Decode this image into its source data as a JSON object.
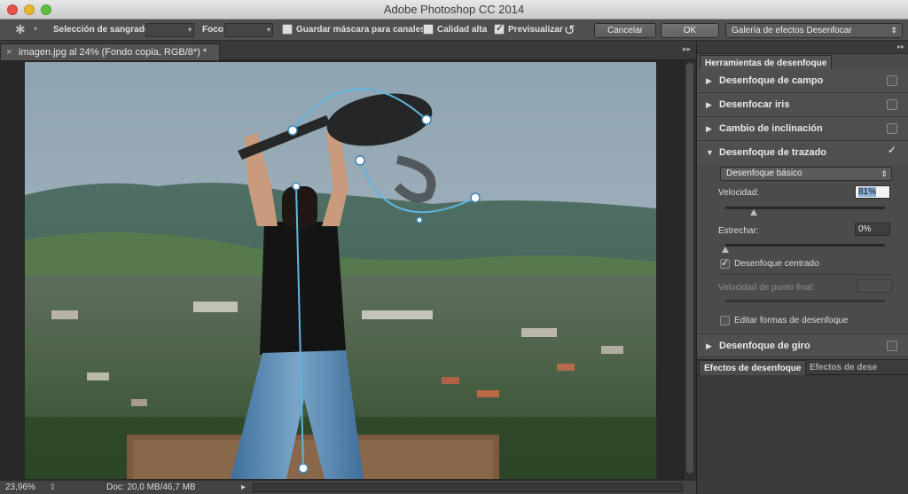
{
  "app": {
    "title": "Adobe Photoshop CC 2014"
  },
  "options_bar": {
    "bleed_label": "Selección de sangrado:",
    "focus_label": "Foco:",
    "save_mask_label": "Guardar máscara para canales",
    "high_quality_label": "Calidad alta",
    "preview_label": "Previsualizar",
    "cancel_label": "Cancelar",
    "ok_label": "OK",
    "gallery_select": "Galería de efectos Desenfocar",
    "preview_checked": true
  },
  "document": {
    "tab_title": "imagen.jpg al 24% (Fondo copia, RGB/8*) *",
    "tab_close": "×"
  },
  "status": {
    "zoom": "23,96%",
    "doc": "Doc: 20,0 MB/46,7 MB"
  },
  "panel": {
    "tab_tools": "Herramientas de desenfoque",
    "sections": [
      {
        "label": "Desenfoque de campo",
        "checked": false
      },
      {
        "label": "Desenfocar iris",
        "checked": false
      },
      {
        "label": "Cambio de inclinación",
        "checked": false
      },
      {
        "label": "Desenfoque de trazado",
        "checked": true
      },
      {
        "label": "Desenfoque de giro",
        "checked": false
      }
    ],
    "path_blur": {
      "mode": "Desenfoque básico",
      "speed_label": "Velocidad:",
      "speed_value": "81%",
      "speed_level": 0.18,
      "taper_label": "Estrechar:",
      "taper_value": "0%",
      "taper_level": 0.0,
      "centered_label": "Desenfoque centrado",
      "centered_checked": true,
      "endpoint_label": "Velocidad de punto final:",
      "edit_shapes_label": "Editar formas de desenfoque",
      "edit_shapes_checked": false
    },
    "bottom_tab_effects": "Efectos de desenfoque",
    "bottom_tab_effects2": "Efectos de dese"
  },
  "colors": {
    "path_line": "#5fb6e0",
    "panel_bg": "#4b4b4b"
  }
}
